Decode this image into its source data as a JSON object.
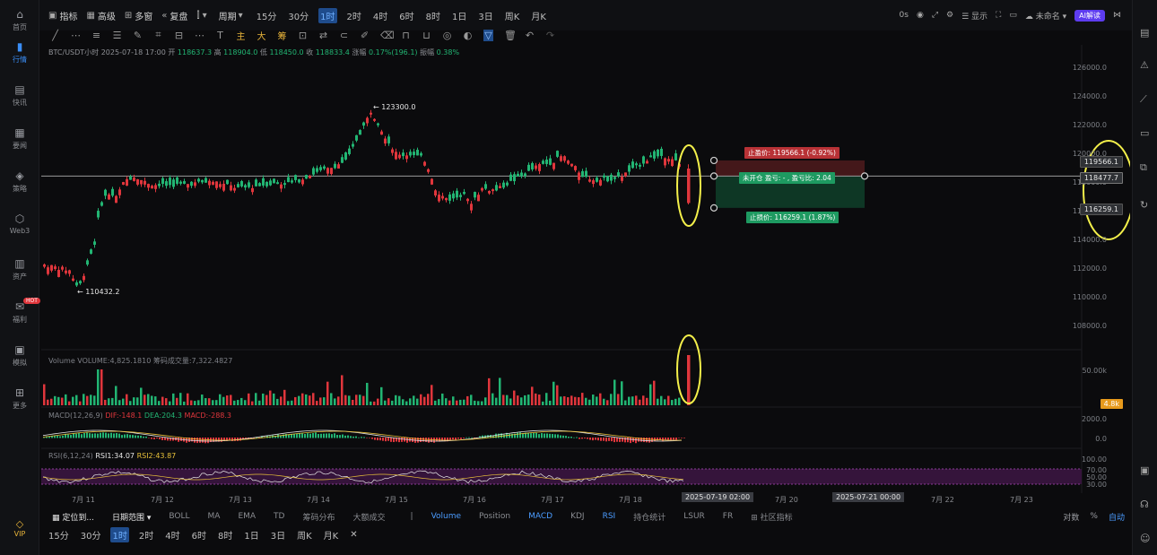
{
  "sidebar": {
    "items": [
      {
        "label": "首页",
        "icon": "home-icon"
      },
      {
        "label": "行情",
        "icon": "chart-bar-icon",
        "active": true
      },
      {
        "label": "快讯",
        "icon": "news-icon"
      },
      {
        "label": "要闻",
        "icon": "document-icon"
      },
      {
        "label": "策略",
        "icon": "strategy-icon"
      },
      {
        "label": "Web3",
        "icon": "web3-icon"
      },
      {
        "label": "资产",
        "icon": "wallet-icon"
      },
      {
        "label": "福利",
        "icon": "gift-icon",
        "badge": "HOT"
      },
      {
        "label": "模拟",
        "icon": "simulate-icon"
      },
      {
        "label": "更多",
        "icon": "grid-icon"
      }
    ],
    "vip": "VIP"
  },
  "topbar": {
    "indicators": "指标",
    "advanced": "高级",
    "multi": "多窗",
    "replay": "复盘",
    "period": "周期",
    "intervals": [
      "15分",
      "30分",
      "1时",
      "2时",
      "4时",
      "6时",
      "8时",
      "1日",
      "3日",
      "周K",
      "月K"
    ],
    "active_interval": "1时",
    "right": {
      "countdown": "0s",
      "display": "显示",
      "unnamed": "未命名",
      "ai": "AI解读"
    }
  },
  "toolbar2": {
    "main": "主",
    "big": "大",
    "chip": "筹"
  },
  "chart": {
    "info": {
      "symbol": "BTC/USDT小时",
      "datetime": "2025-07-18 17:00",
      "open_label": "开",
      "open": "118637.3",
      "high_label": "高",
      "high": "118904.0",
      "low_label": "低",
      "low": "118450.0",
      "close_label": "收",
      "close": "118833.4",
      "change_label": "涨幅",
      "change": "0.17%(196.1)",
      "amp_label": "振幅",
      "amp": "0.38%"
    },
    "price_axis": [
      "126000.0",
      "124000.0",
      "122000.0",
      "120000.0",
      "118000.0",
      "116000.0",
      "114000.0",
      "112000.0",
      "110000.0",
      "108000.0"
    ],
    "high_annotation": "123300.0",
    "low_annotation": "110432.2",
    "take_profit": "止盈价: 119566.1 (-0.92%)",
    "status": "未开仓  盈亏: - , 盈亏比: 2.04",
    "stop_loss": "止损价: 116259.1 (1.87%)",
    "right_labels": {
      "tp": "119566.1",
      "current": "118477.7",
      "sl": "116259.1"
    },
    "volume_label": "Volume  VOLUME:4,825.1810  筹码成交量:7,322.4827",
    "volume_axis": "50.00k",
    "volume_box": "4.8k",
    "macd_label": "MACD(12,26,9)",
    "macd_values": {
      "dif": "DIF:-148.1",
      "dea": "DEA:204.3",
      "macd": "MACD:-288.3"
    },
    "macd_axis": [
      "2000.0",
      "0.0"
    ],
    "rsi_label": "RSI(6,12,24)",
    "rsi_values": {
      "rsi1": "RSI1:34.07",
      "rsi2": "RSI2:43.87"
    },
    "rsi_axis": [
      "100.00",
      "70.00",
      "50.00",
      "30.00"
    ],
    "dates": [
      "7月 11",
      "7月 12",
      "7月 13",
      "7月 14",
      "7月 15",
      "7月 16",
      "7月 17",
      "7月 18",
      "7月 20",
      "7月 22",
      "7月 23"
    ],
    "date_boxes": [
      "2025-07-19 02:00",
      "2025-07-21 00:00"
    ]
  },
  "bottom_tabs": {
    "left": [
      "定位到...",
      "日期范围"
    ],
    "indicators": [
      "BOLL",
      "MA",
      "EMA",
      "TD",
      "筹码分布",
      "大额成交",
      "Volume",
      "Position",
      "MACD",
      "KDJ",
      "RSI",
      "持仓统计",
      "LSUR",
      "FR",
      "社区指标"
    ],
    "blue": [
      "Volume",
      "MACD",
      "RSI"
    ],
    "right": {
      "log": "对数",
      "pct": "%",
      "auto": "自动"
    }
  },
  "interval_bar": [
    "15分",
    "30分",
    "1时",
    "2时",
    "4时",
    "6时",
    "8时",
    "1日",
    "3日",
    "周K",
    "月K"
  ],
  "colors": {
    "up": "#22b573",
    "down": "#e0363c",
    "highlight": "#f3ef4a",
    "accent": "#3a8ef6"
  }
}
